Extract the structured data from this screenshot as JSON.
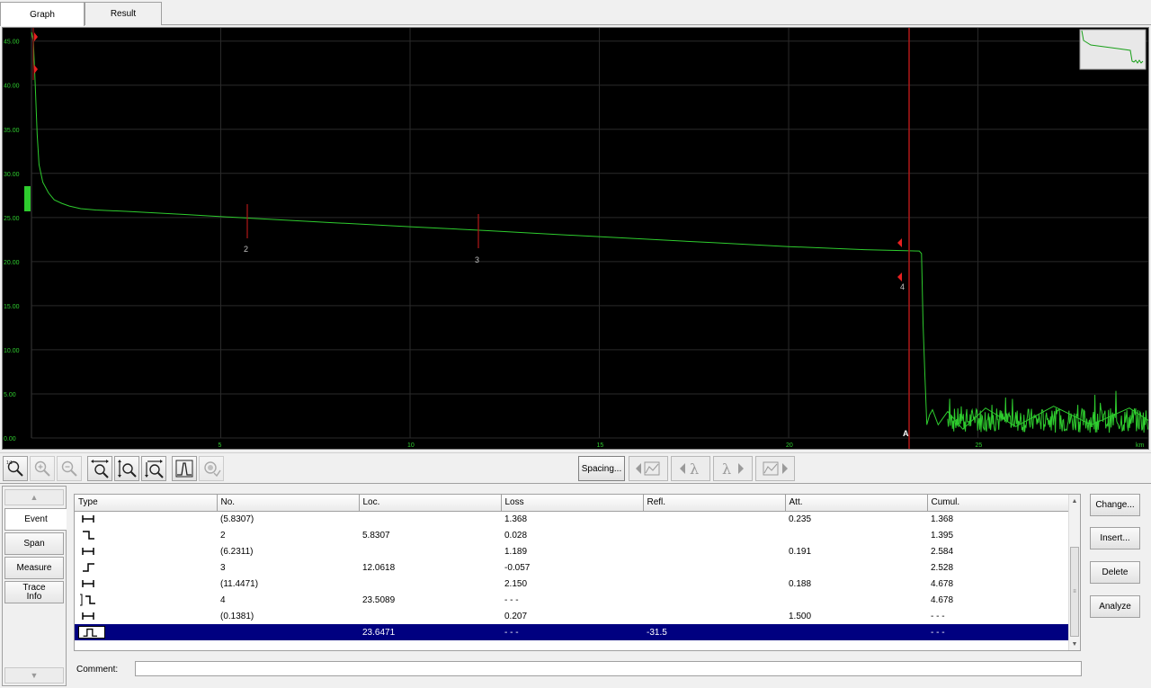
{
  "tabs": [
    {
      "label": "Graph",
      "active": true
    },
    {
      "label": "Result",
      "active": false
    }
  ],
  "graph": {
    "y_ticks": [
      "45.00",
      "40.00",
      "35.00",
      "30.00",
      "25.00",
      "20.00",
      "15.00",
      "10.00",
      "5.00",
      "0.00"
    ],
    "x_ticks": [
      "5",
      "10",
      "15",
      "20",
      "25"
    ],
    "x_unit": "km",
    "event_labels": [
      "2",
      "3",
      "4"
    ],
    "marker_label": "A",
    "colors": {
      "background": "#000000",
      "trace": "#2ecc2e",
      "grid": "#2a2a2a",
      "event_mark": "#b01818",
      "marker": "#b01818"
    }
  },
  "chart_data": {
    "type": "line",
    "xlabel": "km",
    "ylabel": "",
    "xlim": [
      0,
      29.5
    ],
    "ylim": [
      0,
      46.5
    ],
    "grid": true,
    "series": [
      {
        "x": [
          0.0,
          0.05,
          0.1,
          0.15,
          0.2,
          0.3,
          0.45,
          0.6,
          0.8,
          1.0,
          1.3,
          1.7,
          2.5,
          4.0,
          5.8307,
          8.0,
          10.0,
          12.0618,
          14.0,
          16.0,
          18.0,
          20.0,
          22.0,
          23.45,
          23.5089,
          23.55,
          23.6,
          23.65,
          23.72,
          23.8,
          23.95,
          24.2,
          24.6,
          25.2,
          26.0,
          27.0,
          28.0,
          29.0,
          29.5
        ],
        "y": [
          46.0,
          45.0,
          40.0,
          34.5,
          31.0,
          29.0,
          27.8,
          27.0,
          26.6,
          26.3,
          26.0,
          25.85,
          25.7,
          25.35,
          24.9,
          24.4,
          23.95,
          23.5,
          23.05,
          22.6,
          22.15,
          21.7,
          21.35,
          21.2,
          20.9,
          13.0,
          7.0,
          1.5,
          2.6,
          3.2,
          1.5,
          3.0,
          1.0,
          3.4,
          1.3,
          3.6,
          1.5,
          3.4,
          2.0
        ]
      }
    ]
  },
  "toolbar": {
    "spacing_label": "Spacing..."
  },
  "side_nav": [
    {
      "label": "Event",
      "active": true
    },
    {
      "label": "Span",
      "active": false
    },
    {
      "label": "Measure",
      "active": false
    },
    {
      "label": "Trace Info",
      "active": false
    }
  ],
  "table": {
    "columns": [
      "Type",
      "No.",
      "Loc.",
      "Loss",
      "Refl.",
      "Att.",
      "Cumul."
    ],
    "rows": [
      {
        "type": "span",
        "no": "(5.8307)",
        "loc": "",
        "loss": "1.368",
        "refl": "",
        "att": "0.235",
        "cumul": "1.368",
        "selected": false
      },
      {
        "type": "step-down",
        "no": "2",
        "loc": "5.8307",
        "loss": "0.028",
        "refl": "",
        "att": "",
        "cumul": "1.395",
        "selected": false
      },
      {
        "type": "span",
        "no": "(6.2311)",
        "loc": "",
        "loss": "1.189",
        "refl": "",
        "att": "0.191",
        "cumul": "2.584",
        "selected": false
      },
      {
        "type": "step-up",
        "no": "3",
        "loc": "12.0618",
        "loss": "-0.057",
        "refl": "",
        "att": "",
        "cumul": "2.528",
        "selected": false
      },
      {
        "type": "span",
        "no": "(11.4471)",
        "loc": "",
        "loss": "2.150",
        "refl": "",
        "att": "0.188",
        "cumul": "4.678",
        "selected": false
      },
      {
        "type": "end-step-down",
        "no": "4",
        "loc": "23.5089",
        "loss": "- - -",
        "refl": "",
        "att": "",
        "cumul": "4.678",
        "selected": false
      },
      {
        "type": "span",
        "no": "(0.1381)",
        "loc": "",
        "loss": "0.207",
        "refl": "",
        "att": "1.500",
        "cumul": "- - -",
        "selected": false
      },
      {
        "type": "pulse",
        "no": "",
        "loc": "23.6471",
        "loss": "- - -",
        "refl": "-31.5",
        "att": "",
        "cumul": "- - -",
        "selected": true
      }
    ]
  },
  "actions": {
    "change": "Change...",
    "insert": "Insert...",
    "delete": "Delete",
    "analyze": "Analyze"
  },
  "comment": {
    "label": "Comment:",
    "value": ""
  }
}
